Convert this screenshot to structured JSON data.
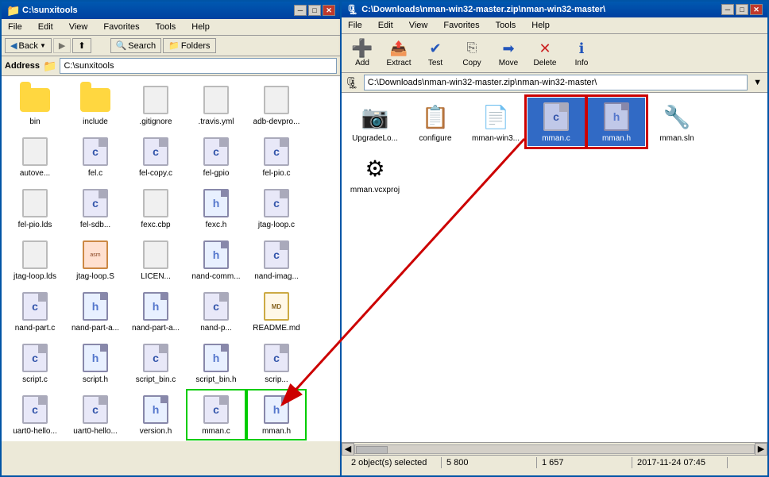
{
  "left_window": {
    "title": "C:\\sunxitools",
    "menu": [
      "File",
      "Edit",
      "View",
      "Favorites",
      "Tools",
      "Help"
    ],
    "toolbar": {
      "back_label": "Back",
      "search_label": "Search",
      "folders_label": "Folders"
    },
    "address_label": "Address",
    "address_value": "C:\\sunxitools",
    "files": [
      {
        "name": "bin",
        "type": "folder"
      },
      {
        "name": "include",
        "type": "folder"
      },
      {
        "name": ".gitignore",
        "type": "generic"
      },
      {
        "name": ".travis.yml",
        "type": "generic"
      },
      {
        "name": "adb-devpro...",
        "type": "generic"
      },
      {
        "name": "autove...",
        "type": "generic"
      },
      {
        "name": "fel.c",
        "type": "c"
      },
      {
        "name": "fel-copy.c",
        "type": "c"
      },
      {
        "name": "fel-gpio",
        "type": "c"
      },
      {
        "name": "fel-pio.c",
        "type": "c"
      },
      {
        "name": "fel-pio.lds",
        "type": "generic"
      },
      {
        "name": "fel-sdb...",
        "type": "c"
      },
      {
        "name": "fexc.cbp",
        "type": "generic"
      },
      {
        "name": "fexc.h",
        "type": "h"
      },
      {
        "name": "jtag-loop.c",
        "type": "c"
      },
      {
        "name": "jtag-loop.lds",
        "type": "generic"
      },
      {
        "name": "jtag-loop.S",
        "type": "asm"
      },
      {
        "name": "LICEN...",
        "type": "generic"
      },
      {
        "name": "nand-comm...",
        "type": "h"
      },
      {
        "name": "nand-imag...",
        "type": "c"
      },
      {
        "name": "nand-part.c",
        "type": "c"
      },
      {
        "name": "nand-part-a...",
        "type": "h"
      },
      {
        "name": "nand-part-a...",
        "type": "h"
      },
      {
        "name": "nand-p...",
        "type": "c"
      },
      {
        "name": "README.md",
        "type": "md"
      },
      {
        "name": "script.c",
        "type": "c"
      },
      {
        "name": "script.h",
        "type": "h"
      },
      {
        "name": "script_bin.c",
        "type": "c"
      },
      {
        "name": "script_bin.h",
        "type": "h"
      },
      {
        "name": "scrip...",
        "type": "c"
      },
      {
        "name": "uart0-hello...",
        "type": "c"
      },
      {
        "name": "uart0-hello...",
        "type": "c"
      },
      {
        "name": "version.h",
        "type": "h"
      },
      {
        "name": "mman.c",
        "type": "c",
        "highlight": "green"
      },
      {
        "name": "mman.h",
        "type": "h",
        "highlight": "green"
      }
    ]
  },
  "right_window": {
    "title": "C:\\Downloads\\nman-win32-master.zip\\nman-win32-master\\",
    "menu": [
      "File",
      "Edit",
      "View",
      "Favorites",
      "Tools",
      "Help"
    ],
    "toolbar": {
      "add_label": "Add",
      "extract_label": "Extract",
      "test_label": "Test",
      "copy_label": "Copy",
      "move_label": "Move",
      "delete_label": "Delete",
      "info_label": "Info"
    },
    "address_value": "C:\\Downloads\\nman-win32-master.zip\\nman-win32-master\\",
    "files": [
      {
        "name": "UpgradeLo...",
        "type": "generic"
      },
      {
        "name": "configure",
        "type": "generic"
      },
      {
        "name": "mman-win3...",
        "type": "generic"
      },
      {
        "name": "mman.c",
        "type": "c",
        "highlight": "red"
      },
      {
        "name": "mman.h",
        "type": "h",
        "highlight": "red"
      },
      {
        "name": "mman.sln",
        "type": "generic"
      },
      {
        "name": "mman.vcxproj",
        "type": "generic"
      }
    ],
    "status": {
      "objects": "2 object(s) selected",
      "size1": "5 800",
      "size2": "1 657",
      "date": "2017-11-24 07:45"
    }
  }
}
